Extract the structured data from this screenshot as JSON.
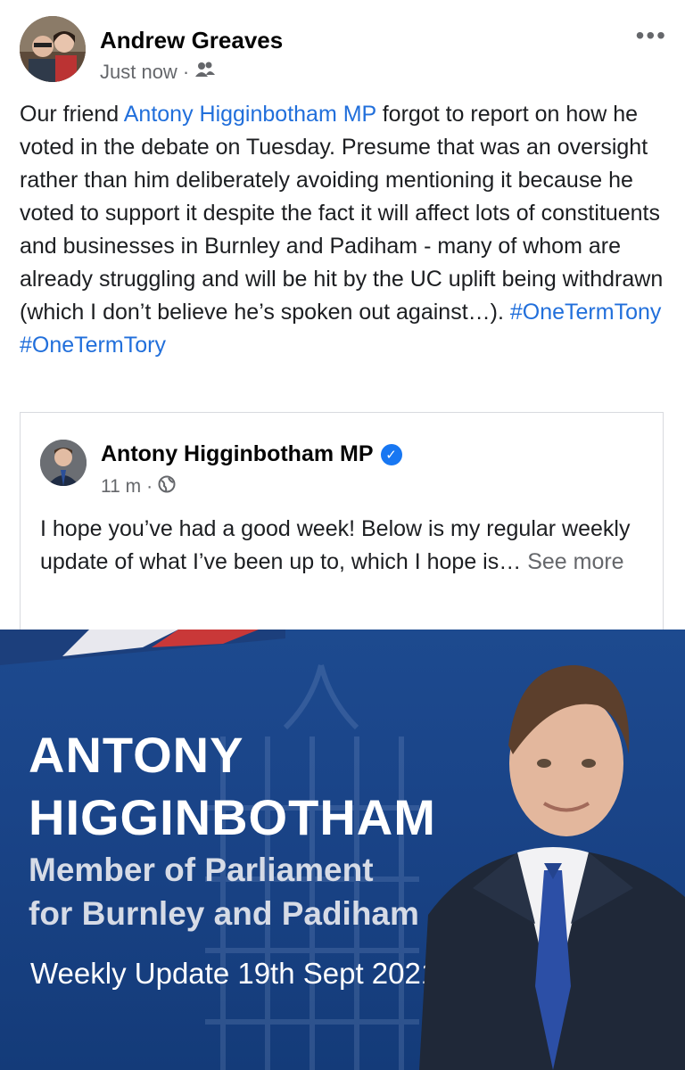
{
  "post": {
    "author": "Andrew Greaves",
    "time": "Just now",
    "audience_icon": "friends-icon",
    "text_before_link": "Our friend ",
    "mention": "Antony Higginbotham MP",
    "text_after_link": " forgot to report on how he voted in the debate on Tuesday. Presume that was an oversight rather than him deliberately avoiding mentioning it because he voted to support it despite the fact it will affect lots of constituents and businesses in Burnley and Padiham - many of whom are already struggling and will be hit by the UC uplift being withdrawn (which I don’t believe he’s spoken out against…). ",
    "hashtag1": "#OneTermTony",
    "hashtag2": "#OneTermTory"
  },
  "shared": {
    "author": "Antony Higginbotham MP",
    "time": "11 m",
    "audience_icon": "globe-icon",
    "text": "I hope you’ve had a good week! Below is my regular weekly update of what I’ve been up to, which I hope is… ",
    "see_more": "See more"
  },
  "banner": {
    "name_line1": "ANTONY",
    "name_line2": "HIGGINBOTHAM",
    "sub_line1": "Member of Parliament",
    "sub_line2": "for Burnley and Padiham",
    "weekly": "Weekly Update 19th Sept 2021"
  },
  "colors": {
    "link": "#216fdb",
    "banner_blue": "#1a4488",
    "verified": "#1877f2"
  }
}
